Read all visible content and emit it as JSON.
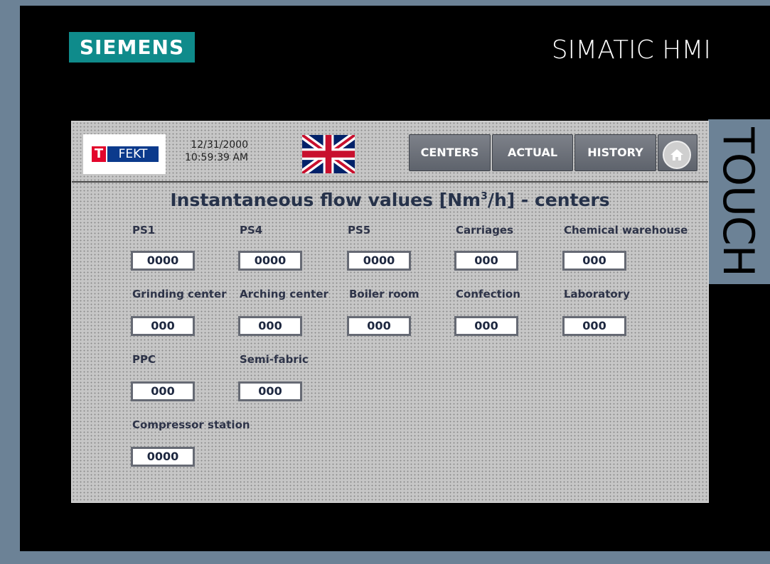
{
  "device": {
    "brand": "SIEMENS",
    "model": "SIMATIC HMI",
    "touch_label": "TOUCH"
  },
  "header": {
    "logo_letter": "T",
    "logo_text": "FEKT",
    "date": "12/31/2000",
    "time": "10:59:39 AM",
    "language_flag": "uk-flag-icon",
    "nav": {
      "centers": "CENTERS",
      "actual": "ACTUAL",
      "history": "HISTORY",
      "home_icon": "home-icon"
    }
  },
  "page": {
    "title_prefix": "Instantaneous flow values [Nm",
    "title_sup": "3",
    "title_suffix": "/h] - centers"
  },
  "fields": {
    "ps1": {
      "label": "PS1",
      "value": "0000"
    },
    "ps4": {
      "label": "PS4",
      "value": "0000"
    },
    "ps5": {
      "label": "PS5",
      "value": "0000"
    },
    "carriages": {
      "label": "Carriages",
      "value": "000"
    },
    "chemical_warehouse": {
      "label": "Chemical warehouse",
      "value": "000"
    },
    "grinding_center": {
      "label": "Grinding center",
      "value": "000"
    },
    "arching_center": {
      "label": "Arching center",
      "value": "000"
    },
    "boiler_room": {
      "label": "Boiler room",
      "value": "000"
    },
    "confection": {
      "label": "Confection",
      "value": "000"
    },
    "laboratory": {
      "label": "Laboratory",
      "value": "000"
    },
    "ppc": {
      "label": "PPC",
      "value": "000"
    },
    "semi_fabric": {
      "label": "Semi-fabric",
      "value": "000"
    },
    "compressor_station": {
      "label": "Compressor station",
      "value": "0000"
    }
  },
  "colors": {
    "siemens_teal": "#0f8b8b",
    "bezel": "#000000",
    "frame": "#6c8296",
    "screen": "#c6c6c6"
  }
}
